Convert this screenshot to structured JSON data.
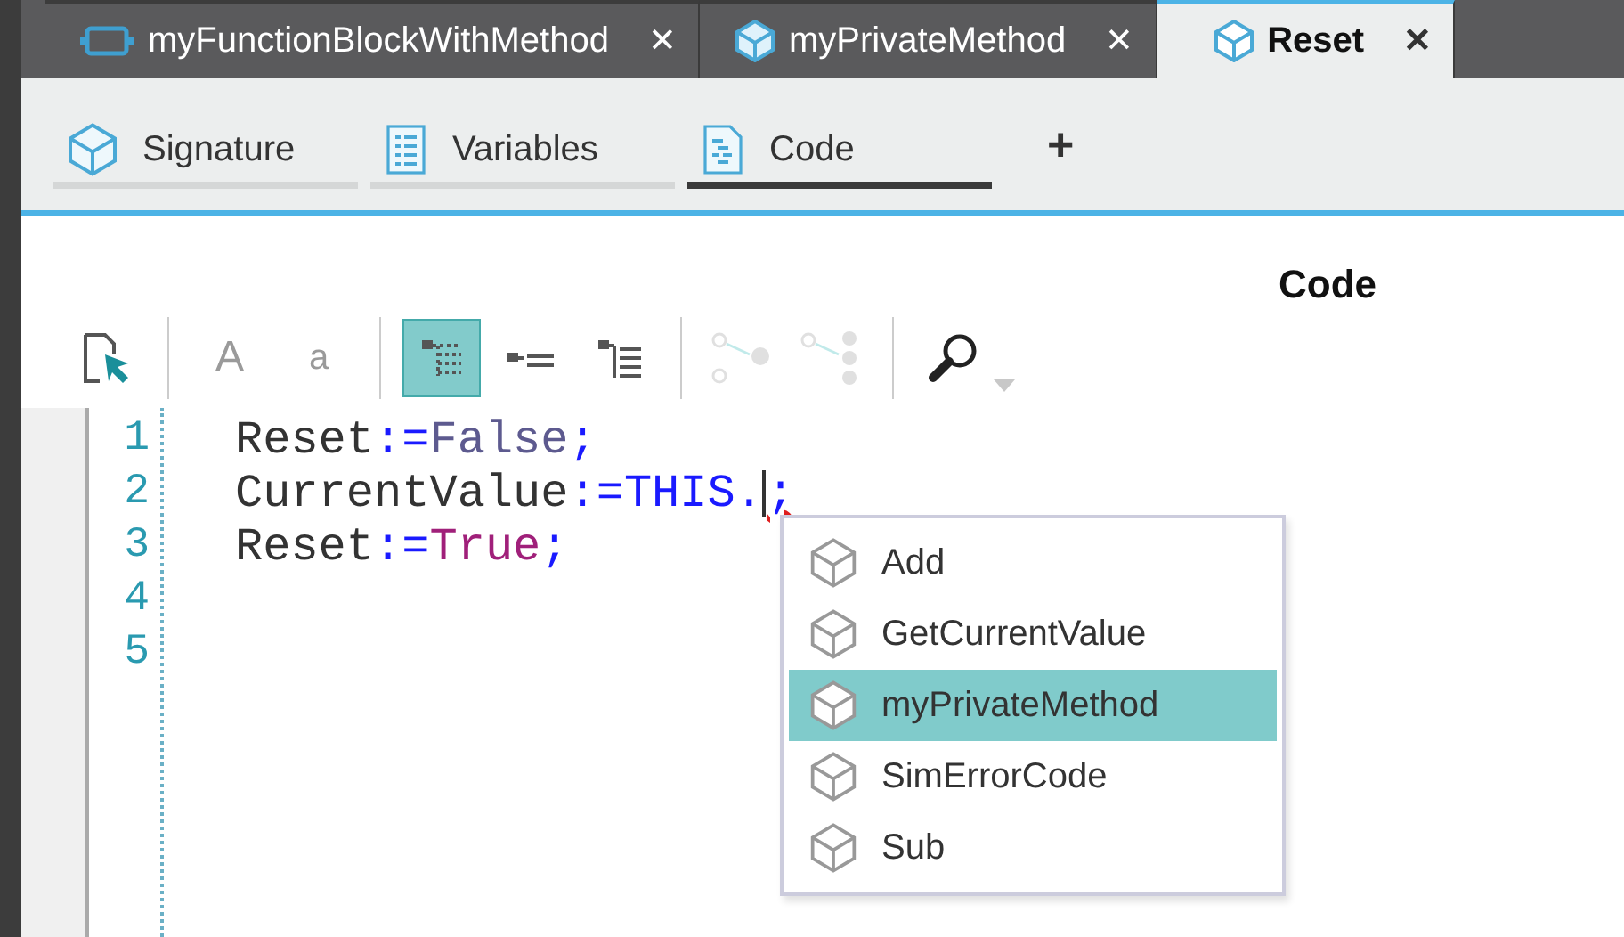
{
  "editor_tabs": [
    {
      "label": "myFunctionBlockWithMethod",
      "kind": "block",
      "selected": false,
      "close": "✕"
    },
    {
      "label": "myPrivateMethod",
      "kind": "method",
      "selected": false,
      "close": "✕"
    },
    {
      "label": "Reset",
      "kind": "method",
      "selected": true,
      "close": "✕"
    }
  ],
  "view_tabs": [
    {
      "label": "Signature",
      "kind": "method",
      "selected": false
    },
    {
      "label": "Variables",
      "kind": "list",
      "selected": false
    },
    {
      "label": "Code",
      "kind": "code",
      "selected": true
    }
  ],
  "add_tab": "+",
  "panel_title": "Code",
  "toolbar": [
    {
      "kind": "select-page",
      "disabled": false,
      "selected": false
    },
    {
      "kind": "separator"
    },
    {
      "kind": "glyph-large",
      "text": "A",
      "disabled": true,
      "selected": false
    },
    {
      "kind": "glyph-small",
      "text": "a",
      "disabled": true,
      "selected": false
    },
    {
      "kind": "separator"
    },
    {
      "kind": "outline",
      "disabled": false,
      "selected": true
    },
    {
      "kind": "indent-list",
      "disabled": false,
      "selected": false
    },
    {
      "kind": "tree-list",
      "disabled": false,
      "selected": false
    },
    {
      "kind": "separator"
    },
    {
      "kind": "graph-a",
      "disabled": true,
      "selected": false
    },
    {
      "kind": "graph-b",
      "disabled": true,
      "selected": false
    },
    {
      "kind": "separator"
    },
    {
      "kind": "search",
      "disabled": false,
      "selected": false
    }
  ],
  "code_lines": [
    {
      "number": "1",
      "tokens": [
        {
          "text": "Reset",
          "kind": "ident"
        },
        {
          "text": ":=",
          "kind": "op"
        },
        {
          "text": "False",
          "kind": "const"
        },
        {
          "text": ";",
          "kind": "op"
        }
      ]
    },
    {
      "number": "2",
      "tokens": [
        {
          "text": "CurrentValue",
          "kind": "ident"
        },
        {
          "text": ":=",
          "kind": "op"
        },
        {
          "text": "THIS",
          "kind": "keyword"
        },
        {
          "text": ".",
          "kind": "op"
        },
        {
          "text": ";",
          "kind": "op",
          "caret_before": true,
          "error": true
        }
      ]
    },
    {
      "number": "3",
      "tokens": [
        {
          "text": "Reset",
          "kind": "ident"
        },
        {
          "text": ":=",
          "kind": "op"
        },
        {
          "text": "True",
          "kind": "literal"
        },
        {
          "text": ";",
          "kind": "op"
        }
      ]
    },
    {
      "number": "4"
    },
    {
      "number": "5"
    }
  ],
  "completion": [
    {
      "label": "Add",
      "selected": false
    },
    {
      "label": "GetCurrentValue",
      "selected": false
    },
    {
      "label": "myPrivateMethod",
      "selected": true
    },
    {
      "label": "SimErrorCode",
      "selected": false
    },
    {
      "label": "Sub",
      "selected": false
    }
  ]
}
